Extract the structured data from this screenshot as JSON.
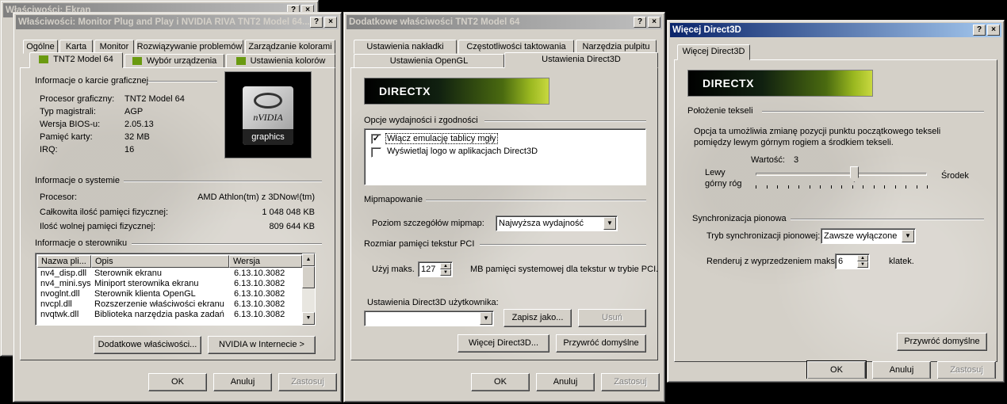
{
  "win_ekran": {
    "title": "Właściwości: Ekran"
  },
  "win_monitor": {
    "title": "Właściwości: Monitor Plug and Play i NVIDIA RIVA TNT2 Model 64...",
    "tabs_row1": [
      "Ogólne",
      "Karta",
      "Monitor",
      "Rozwiązywanie problemów",
      "Zarządzanie kolorami"
    ],
    "tabs_row2": [
      "TNT2 Model 64",
      "Wybór urządzenia",
      "Ustawienia kolorów"
    ],
    "card_group": "Informacje o karcie graficznej",
    "card_rows": [
      {
        "k": "Procesor graficzny:",
        "v": "TNT2 Model 64"
      },
      {
        "k": "Typ magistrali:",
        "v": "AGP"
      },
      {
        "k": "Wersja BIOS-u:",
        "v": "2.05.13"
      },
      {
        "k": "Pamięć karty:",
        "v": "32 MB"
      },
      {
        "k": "IRQ:",
        "v": "16"
      }
    ],
    "logo_brand": "nVIDIA",
    "logo_sub": "graphics",
    "sys_group": "Informacje o systemie",
    "sys_rows": [
      {
        "k": "Procesor:",
        "v": "AMD Athlon(tm) z 3DNow!(tm)"
      },
      {
        "k": "Całkowita ilość pamięci fizycznej:",
        "v": "1 048 048 KB"
      },
      {
        "k": "Ilość wolnej pamięci fizycznej:",
        "v": "809 644 KB"
      }
    ],
    "drv_group": "Informacje o sterowniku",
    "drv_cols": [
      "Nazwa pli...",
      "Opis",
      "Wersja"
    ],
    "drv_rows": [
      {
        "n": "nv4_disp.dll",
        "d": "Sterownik ekranu",
        "v": "6.13.10.3082"
      },
      {
        "n": "nv4_mini.sys",
        "d": "Miniport sterownika ekranu",
        "v": "6.13.10.3082"
      },
      {
        "n": "nvoglnt.dll",
        "d": "Sterownik klienta OpenGL",
        "v": "6.13.10.3082"
      },
      {
        "n": "nvcpl.dll",
        "d": "Rozszerzenie właściwości ekranu",
        "v": "6.13.10.3082"
      },
      {
        "n": "nvqtwk.dll",
        "d": "Biblioteka narzędzia paska zadań",
        "v": "6.13.10.3082"
      }
    ],
    "btn_more": "Dodatkowe właściwości...",
    "btn_web": "NVIDIA w Internecie >",
    "ok": "OK",
    "cancel": "Anuluj",
    "apply": "Zastosuj"
  },
  "win_extra": {
    "title": "Dodatkowe właściwości TNT2 Model 64",
    "tabs_row1": [
      "Ustawienia nakładki",
      "Częstotliwości taktowania",
      "Narzędzia pulpitu"
    ],
    "tabs_row2": [
      "Ustawienia OpenGL",
      "Ustawienia Direct3D"
    ],
    "dx_logo": "DIRECTX",
    "perf_group": "Opcje wydajności i zgodności",
    "opt1": "Włącz emulację tablicy mgły",
    "opt1_mark": "✓",
    "opt2": "Wyświetlaj logo w aplikacjach Direct3D",
    "mip_group": "Mipmapowanie",
    "mip_label": "Poziom szczegółów mipmap:",
    "mip_value": "Najwyższa wydajność",
    "pci_group": "Rozmiar pamięci tekstur PCI",
    "pci_label": "Użyj maks.",
    "pci_value": "127",
    "pci_suffix": "MB pamięci systemowej dla tekstur w trybie PCI.",
    "user_group": "Ustawienia Direct3D użytkownika:",
    "user_value": "",
    "btn_save": "Zapisz jako...",
    "btn_delete": "Usuń",
    "btn_more": "Więcej Direct3D...",
    "btn_defaults": "Przywróć domyślne",
    "ok": "OK",
    "cancel": "Anuluj",
    "apply": "Zastosuj"
  },
  "win_d3d": {
    "title": "Więcej Direct3D",
    "tab": "Więcej Direct3D",
    "dx_logo": "DIRECTX",
    "texel_group": "Położenie tekseli",
    "texel_desc1": "Opcja ta umożliwia zmianę pozycji punktu początkowego tekseli",
    "texel_desc2": "pomiędzy lewym górnym rogiem a środkiem tekseli.",
    "value_label": "Wartość:",
    "value": "3",
    "slider_position": 0.58,
    "left_label1": "Lewy",
    "left_label2": "górny róg",
    "right_label": "Środek",
    "vsync_group": "Synchronizacja pionowa",
    "vsync_label": "Tryb synchronizacji pionowej:",
    "vsync_value": "Zawsze wyłączone",
    "prerender_label": "Renderuj z wyprzedzeniem maks.",
    "prerender_value": "6",
    "prerender_suffix": "klatek.",
    "btn_defaults": "Przywróć domyślne",
    "ok": "OK",
    "cancel": "Anuluj",
    "apply": "Zastosuj"
  },
  "icons": {
    "help": "?",
    "close": "×",
    "down": "▼",
    "up": "▲"
  }
}
